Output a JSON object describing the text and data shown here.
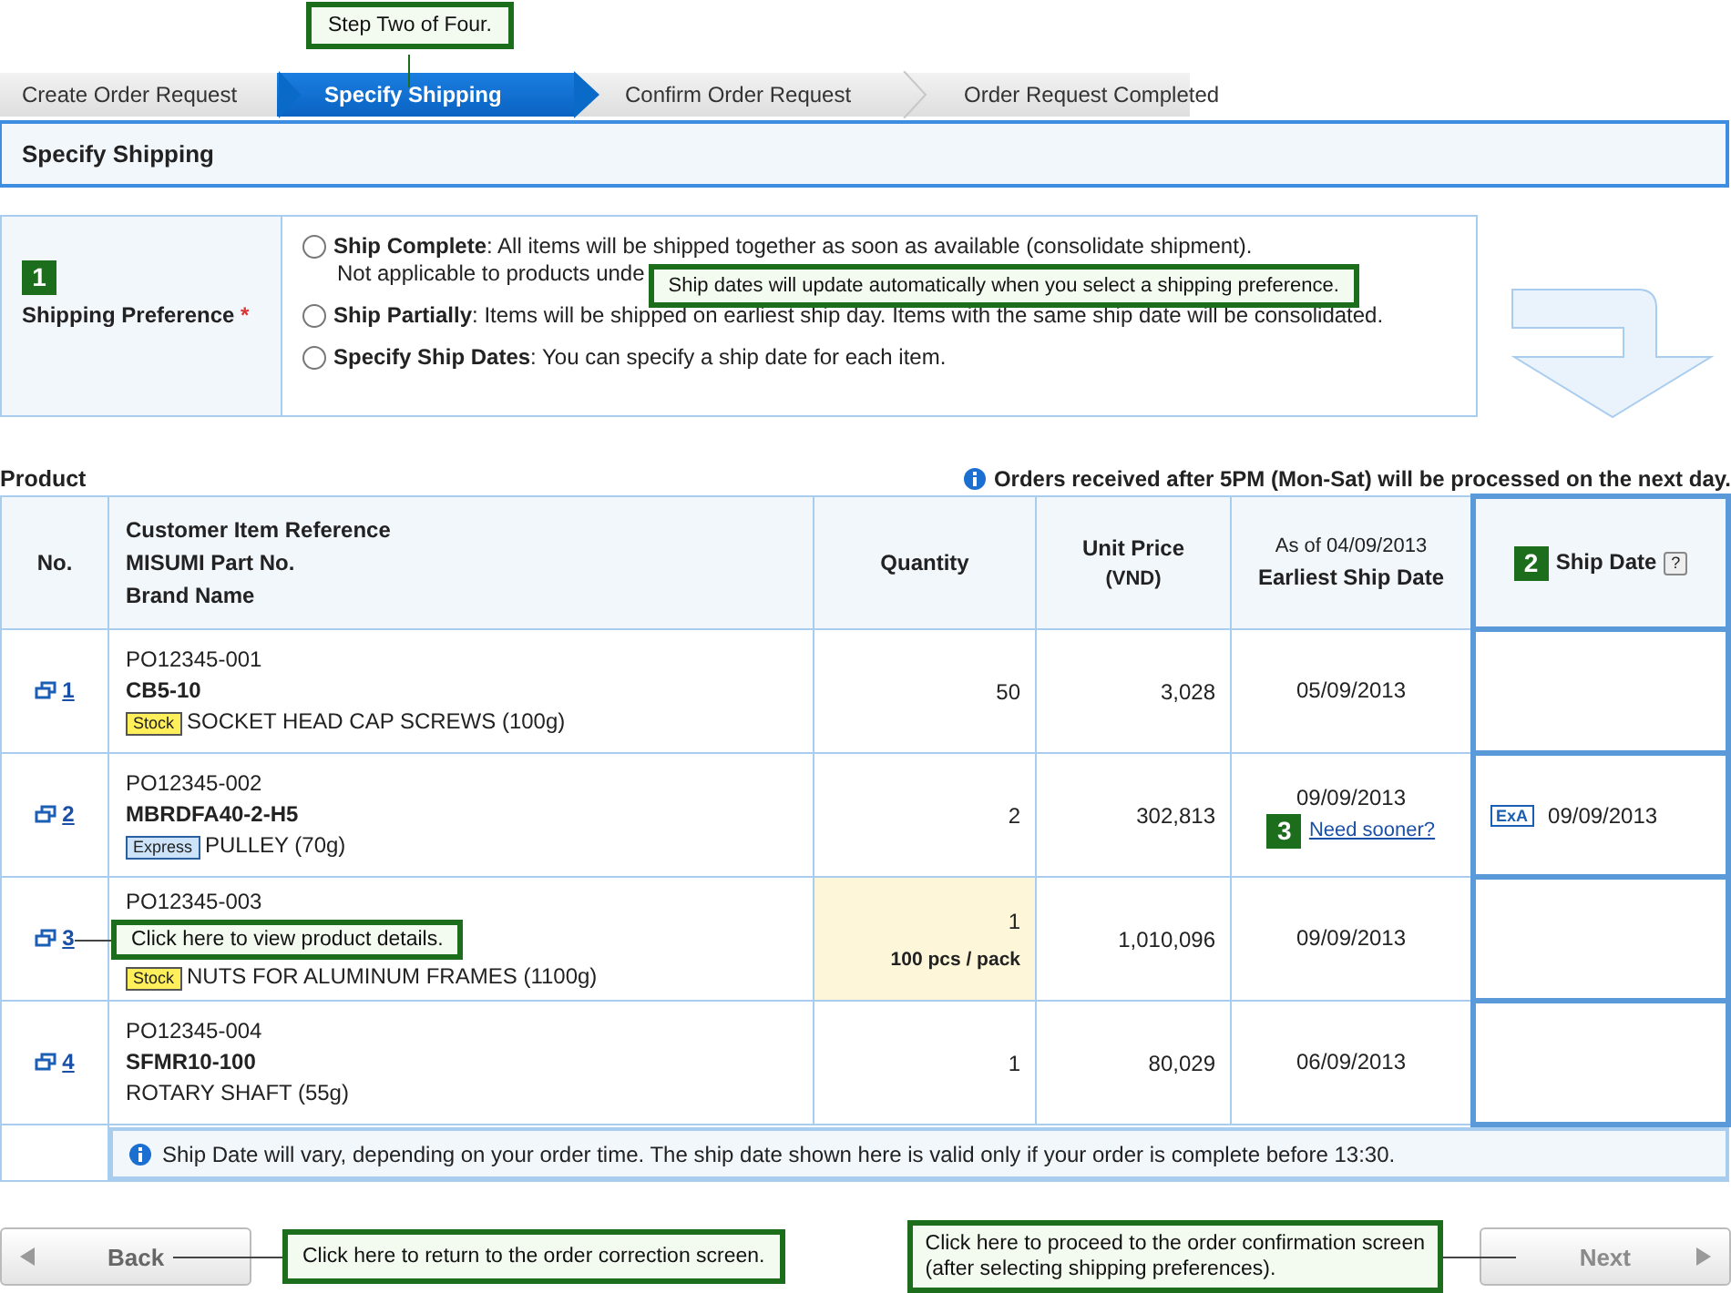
{
  "steps": [
    {
      "label": "Create Order Request",
      "selected": false
    },
    {
      "label": "Specify Shipping",
      "selected": true
    },
    {
      "label": "Confirm Order Request",
      "selected": false
    },
    {
      "label": "Order Request Completed",
      "selected": false
    }
  ],
  "step_callout": "Step Two of Four.",
  "section_title": "Specify Shipping",
  "preference": {
    "marker": "1",
    "label": "Shipping Preference",
    "required": "*",
    "options": [
      {
        "title": "Ship Complete",
        "text": ": All items will be shipped together as soon as available (consolidate shipment).",
        "note": "Not applicable to products unde",
        "selected": false
      },
      {
        "title": "Ship Partially",
        "text": ": Items will be shipped on earliest ship day. Items with the same ship date will be consolidated.",
        "selected": false
      },
      {
        "title": "Specify Ship Dates",
        "text": ": You can specify a ship date for each item.",
        "selected": false
      }
    ],
    "callout": "Ship dates will update automatically when you select a shipping preference."
  },
  "product_heading": "Product",
  "notice": "Orders received after 5PM (Mon-Sat) will be processed on the next day.",
  "header": {
    "no": "No.",
    "reference_lines": [
      "Customer Item Reference",
      "MISUMI Part No.",
      "Brand Name"
    ],
    "quantity": "Quantity",
    "unit_price": "Unit Price",
    "currency": "(VND)",
    "as_of": "As of 04/09/2013",
    "earliest": "Earliest Ship Date",
    "ship_marker": "2",
    "ship_date": "Ship Date",
    "help": "?"
  },
  "rows": [
    {
      "no": "1",
      "reference": "PO12345-001",
      "part_no": "CB5-10",
      "tag": {
        "kind": "stock",
        "label": "Stock"
      },
      "brand": "SOCKET HEAD CAP SCREWS (100g)",
      "quantity": "50",
      "highlighted": false,
      "unit_price": "3,028",
      "earliest": "05/09/2013"
    },
    {
      "no": "2",
      "reference": "PO12345-002",
      "part_no": "MBRDFA40-2-H5",
      "tag": {
        "kind": "express",
        "label": "Express"
      },
      "brand": "PULLEY (70g)",
      "quantity": "2",
      "highlighted": false,
      "unit_price": "302,813",
      "earliest": "09/09/2013",
      "marker": "3",
      "need_sooner": "Need sooner?",
      "ship_icon": "ExA",
      "ship_date": "09/09/2013"
    },
    {
      "no": "3",
      "reference": "PO12345-003",
      "tag": {
        "kind": "stock",
        "label": "Stock"
      },
      "brand": "NUTS FOR ALUMINUM FRAMES (1100g)",
      "quantity": "1",
      "pack": "100 pcs / pack",
      "highlighted": true,
      "unit_price": "1,010,096",
      "earliest": "09/09/2013",
      "callout": "Click here to view product details."
    },
    {
      "no": "4",
      "reference": "PO12345-004",
      "part_no": "SFMR10-100",
      "brand": "ROTARY SHAFT (55g)",
      "quantity": "1",
      "highlighted": false,
      "unit_price": "80,029",
      "earliest": "06/09/2013"
    }
  ],
  "footnote": "Ship Date will vary, depending on your order time. The ship date shown here is valid only if your order is complete before 13:30.",
  "back": {
    "label": "Back",
    "disabled": false,
    "callout": "Click here to return to the order correction screen."
  },
  "next": {
    "label": "Next",
    "disabled": true,
    "callout_lines": [
      "Click here to proceed to the order confirmation screen",
      "(after selecting shipping preferences)."
    ]
  }
}
